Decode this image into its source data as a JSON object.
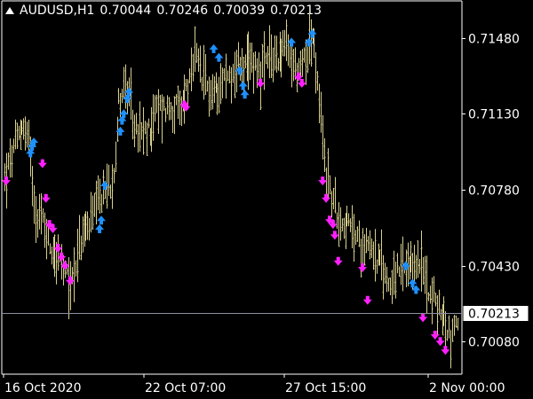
{
  "header": {
    "symbol": "AUDUSD,H1",
    "open": "0.70044",
    "high": "0.70246",
    "low": "0.70039",
    "close": "0.70213"
  },
  "colors": {
    "background": "#000000",
    "bars": "#d8cf8e",
    "buy_arrow": "#1e90ff",
    "sell_arrow": "#ff20ff",
    "axis": "#ffffff",
    "price_line": "#8a8fa0"
  },
  "chart_data": {
    "type": "ohlc-bars",
    "symbol": "AUDUSD",
    "timeframe": "H1",
    "ylim": [
      0.6993,
      0.7165
    ],
    "y_ticks": [
      "0.71480",
      "0.71130",
      "0.70780",
      "0.70430",
      "0.70080"
    ],
    "x_ticks": [
      "16 Oct 2020",
      "22 Oct 07:00",
      "27 Oct 15:00",
      "2 Nov 00:00"
    ],
    "current_price": "0.70213",
    "anchors": [
      [
        0,
        0.7083
      ],
      [
        6,
        0.7098
      ],
      [
        10,
        0.7108
      ],
      [
        14,
        0.7101
      ],
      [
        16,
        0.7083
      ],
      [
        18,
        0.7068
      ],
      [
        22,
        0.7064
      ],
      [
        26,
        0.7052
      ],
      [
        31,
        0.7047
      ],
      [
        34,
        0.704
      ],
      [
        38,
        0.7034
      ],
      [
        42,
        0.7049
      ],
      [
        46,
        0.7058
      ],
      [
        52,
        0.7067
      ],
      [
        58,
        0.7078
      ],
      [
        62,
        0.7082
      ],
      [
        64,
        0.7097
      ],
      [
        66,
        0.7118
      ],
      [
        69,
        0.7126
      ],
      [
        72,
        0.7119
      ],
      [
        76,
        0.7104
      ],
      [
        82,
        0.7103
      ],
      [
        88,
        0.7115
      ],
      [
        96,
        0.7116
      ],
      [
        102,
        0.7114
      ],
      [
        104,
        0.7123
      ],
      [
        108,
        0.7128
      ],
      [
        110,
        0.714
      ],
      [
        114,
        0.7129
      ],
      [
        120,
        0.7122
      ],
      [
        126,
        0.7129
      ],
      [
        132,
        0.7131
      ],
      [
        136,
        0.7136
      ],
      [
        140,
        0.7133
      ],
      [
        144,
        0.7138
      ],
      [
        148,
        0.7132
      ],
      [
        152,
        0.7137
      ],
      [
        158,
        0.714
      ],
      [
        162,
        0.7144
      ],
      [
        166,
        0.7137
      ],
      [
        170,
        0.7131
      ],
      [
        174,
        0.7141
      ],
      [
        178,
        0.7149
      ],
      [
        180,
        0.7134
      ],
      [
        182,
        0.7117
      ],
      [
        186,
        0.7086
      ],
      [
        190,
        0.7072
      ],
      [
        194,
        0.7064
      ],
      [
        198,
        0.7062
      ],
      [
        202,
        0.7058
      ],
      [
        206,
        0.7052
      ],
      [
        210,
        0.7056
      ],
      [
        214,
        0.7047
      ],
      [
        218,
        0.7043
      ],
      [
        222,
        0.7035
      ],
      [
        226,
        0.7039
      ],
      [
        230,
        0.7041
      ],
      [
        234,
        0.7039
      ],
      [
        238,
        0.7046
      ],
      [
        242,
        0.704
      ],
      [
        246,
        0.7031
      ],
      [
        250,
        0.7024
      ],
      [
        254,
        0.7018
      ],
      [
        258,
        0.701
      ],
      [
        262,
        0.7019
      ]
    ],
    "buy_signals": [
      [
        15,
        0.7095
      ],
      [
        16,
        0.7098
      ],
      [
        17,
        0.71
      ],
      [
        55,
        0.706
      ],
      [
        56,
        0.7064
      ],
      [
        58,
        0.708
      ],
      [
        67,
        0.7105
      ],
      [
        68,
        0.711
      ],
      [
        69,
        0.7113
      ],
      [
        71,
        0.712
      ],
      [
        72,
        0.7123
      ],
      [
        121,
        0.7143
      ],
      [
        124,
        0.7139
      ],
      [
        136,
        0.7133
      ],
      [
        138,
        0.7126
      ],
      [
        139,
        0.7122
      ],
      [
        166,
        0.7146
      ],
      [
        176,
        0.7146
      ],
      [
        178,
        0.715
      ],
      [
        232,
        0.7043
      ],
      [
        236,
        0.7035
      ],
      [
        238,
        0.7032
      ]
    ],
    "sell_signals": [
      [
        1,
        0.7082
      ],
      [
        22,
        0.709
      ],
      [
        24,
        0.7074
      ],
      [
        26,
        0.7062
      ],
      [
        28,
        0.706
      ],
      [
        31,
        0.7051
      ],
      [
        33,
        0.7047
      ],
      [
        35,
        0.7043
      ],
      [
        38,
        0.7036
      ],
      [
        104,
        0.7117
      ],
      [
        105,
        0.7116
      ],
      [
        148,
        0.7127
      ],
      [
        170,
        0.713
      ],
      [
        172,
        0.7127
      ],
      [
        184,
        0.7082
      ],
      [
        186,
        0.7074
      ],
      [
        188,
        0.7064
      ],
      [
        190,
        0.7062
      ],
      [
        191,
        0.7057
      ],
      [
        193,
        0.7045
      ],
      [
        207,
        0.7042
      ],
      [
        210,
        0.7027
      ],
      [
        242,
        0.7019
      ],
      [
        249,
        0.7011
      ],
      [
        252,
        0.7008
      ],
      [
        255,
        0.7004
      ]
    ]
  }
}
